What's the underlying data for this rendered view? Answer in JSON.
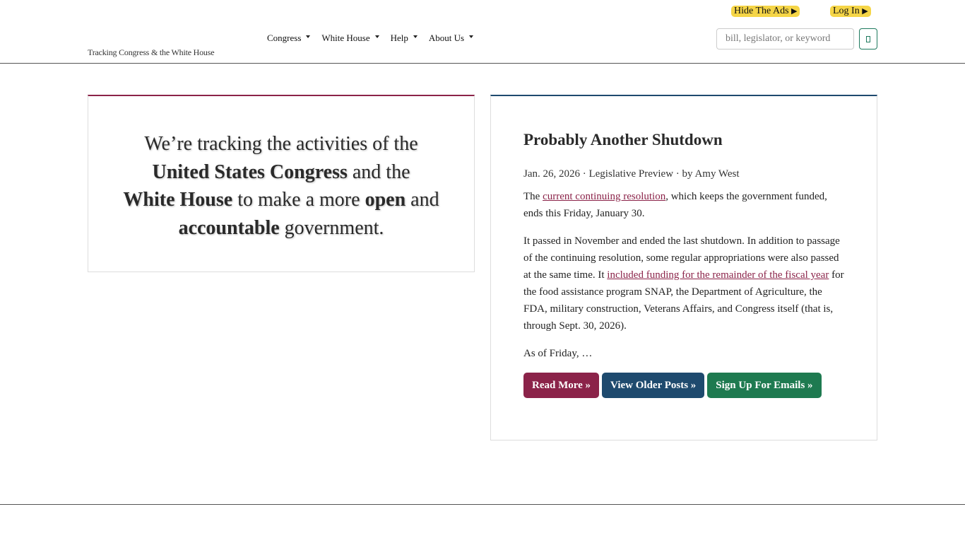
{
  "header": {
    "tagline": "Tracking Congress & the White House",
    "util_links": {
      "hide_ads": "Hide The Ads",
      "log_in": "Log In",
      "arrow": "▶"
    },
    "nav": [
      "Congress",
      "White House",
      "Help",
      "About Us"
    ],
    "search": {
      "placeholder": "bill, legislator, or keyword",
      "button_icon": "search-icon"
    }
  },
  "mission": {
    "line1": "We’re tracking the activities of the",
    "congress": "United States Congress",
    "and_the": " and the",
    "white_house": "White House",
    "to_make": " to make a more ",
    "open": "open",
    "and": " and",
    "accountable": "accountable",
    "government": " government."
  },
  "post": {
    "title": "Probably Another Shutdown",
    "meta": "Jan. 26, 2026 · Legislative Preview · by Amy West",
    "p1_before": "The ",
    "p1_link": "current continuing resolution",
    "p1_after": ", which keeps the government funded, ends this Friday, January 30.",
    "p2_before": "It passed in November and ended the last shutdown. In addition to passage of the continuing resolution, some regular appropriations were also passed at the same time. It ",
    "p2_link": "included funding for the remainder of the fiscal year",
    "p2_after": " for the food assistance program SNAP, the Department of Agriculture, the FDA, military construction, Veterans Affairs, and Congress itself (that is, through Sept. 30, 2026).",
    "p3": "As of Friday, …"
  },
  "buttons": {
    "read_more": "Read More »",
    "older_posts": "View Older Posts »",
    "sign_up": "Sign Up For Emails »"
  },
  "colors": {
    "accent_maroon": "#8b2349",
    "accent_navy": "#1e4a6e",
    "accent_green": "#1e7a50",
    "util_yellow": "#f5d547"
  }
}
